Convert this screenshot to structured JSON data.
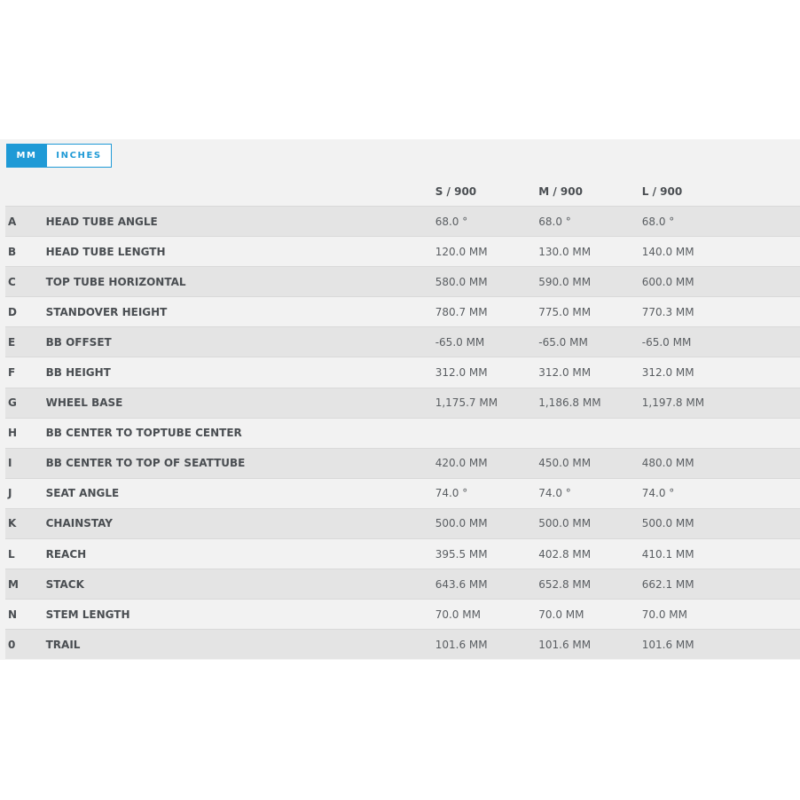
{
  "units": {
    "mm_label": "MM",
    "inches_label": "INCHES",
    "active": "MM"
  },
  "table": {
    "columns": [
      "S / 900",
      "M / 900",
      "L / 900"
    ],
    "rows": [
      {
        "letter": "A",
        "label": "HEAD TUBE ANGLE",
        "s": "68.0 °",
        "m": "68.0 °",
        "l": "68.0 °"
      },
      {
        "letter": "B",
        "label": "HEAD TUBE LENGTH",
        "s": "120.0 MM",
        "m": "130.0 MM",
        "l": "140.0 MM"
      },
      {
        "letter": "C",
        "label": "TOP TUBE HORIZONTAL",
        "s": "580.0 MM",
        "m": "590.0 MM",
        "l": "600.0 MM"
      },
      {
        "letter": "D",
        "label": "STANDOVER HEIGHT",
        "s": "780.7 MM",
        "m": "775.0 MM",
        "l": "770.3 MM"
      },
      {
        "letter": "E",
        "label": "BB OFFSET",
        "s": "-65.0 MM",
        "m": "-65.0 MM",
        "l": "-65.0 MM"
      },
      {
        "letter": "F",
        "label": "BB HEIGHT",
        "s": "312.0 MM",
        "m": "312.0 MM",
        "l": "312.0 MM"
      },
      {
        "letter": "G",
        "label": "WHEEL BASE",
        "s": "1,175.7 MM",
        "m": "1,186.8 MM",
        "l": "1,197.8 MM"
      },
      {
        "letter": "H",
        "label": "BB CENTER TO TOPTUBE CENTER",
        "s": "",
        "m": "",
        "l": ""
      },
      {
        "letter": "I",
        "label": "BB CENTER TO TOP OF SEATTUBE",
        "s": "420.0 MM",
        "m": "450.0 MM",
        "l": "480.0 MM"
      },
      {
        "letter": "J",
        "label": "SEAT ANGLE",
        "s": "74.0 °",
        "m": "74.0 °",
        "l": "74.0 °"
      },
      {
        "letter": "K",
        "label": "CHAINSTAY",
        "s": "500.0 MM",
        "m": "500.0 MM",
        "l": "500.0 MM"
      },
      {
        "letter": "L",
        "label": "REACH",
        "s": "395.5 MM",
        "m": "402.8 MM",
        "l": "410.1 MM"
      },
      {
        "letter": "M",
        "label": "STACK",
        "s": "643.6 MM",
        "m": "652.8 MM",
        "l": "662.1 MM"
      },
      {
        "letter": "N",
        "label": "STEM LENGTH",
        "s": "70.0 MM",
        "m": "70.0 MM",
        "l": "70.0 MM"
      },
      {
        "letter": "0",
        "label": "TRAIL",
        "s": "101.6 MM",
        "m": "101.6 MM",
        "l": "101.6 MM"
      }
    ]
  },
  "colors": {
    "accent": "#1f9ad6",
    "row_shade": "#e4e4e4",
    "row_plain": "#f2f2f2",
    "text": "#4a4e52"
  }
}
